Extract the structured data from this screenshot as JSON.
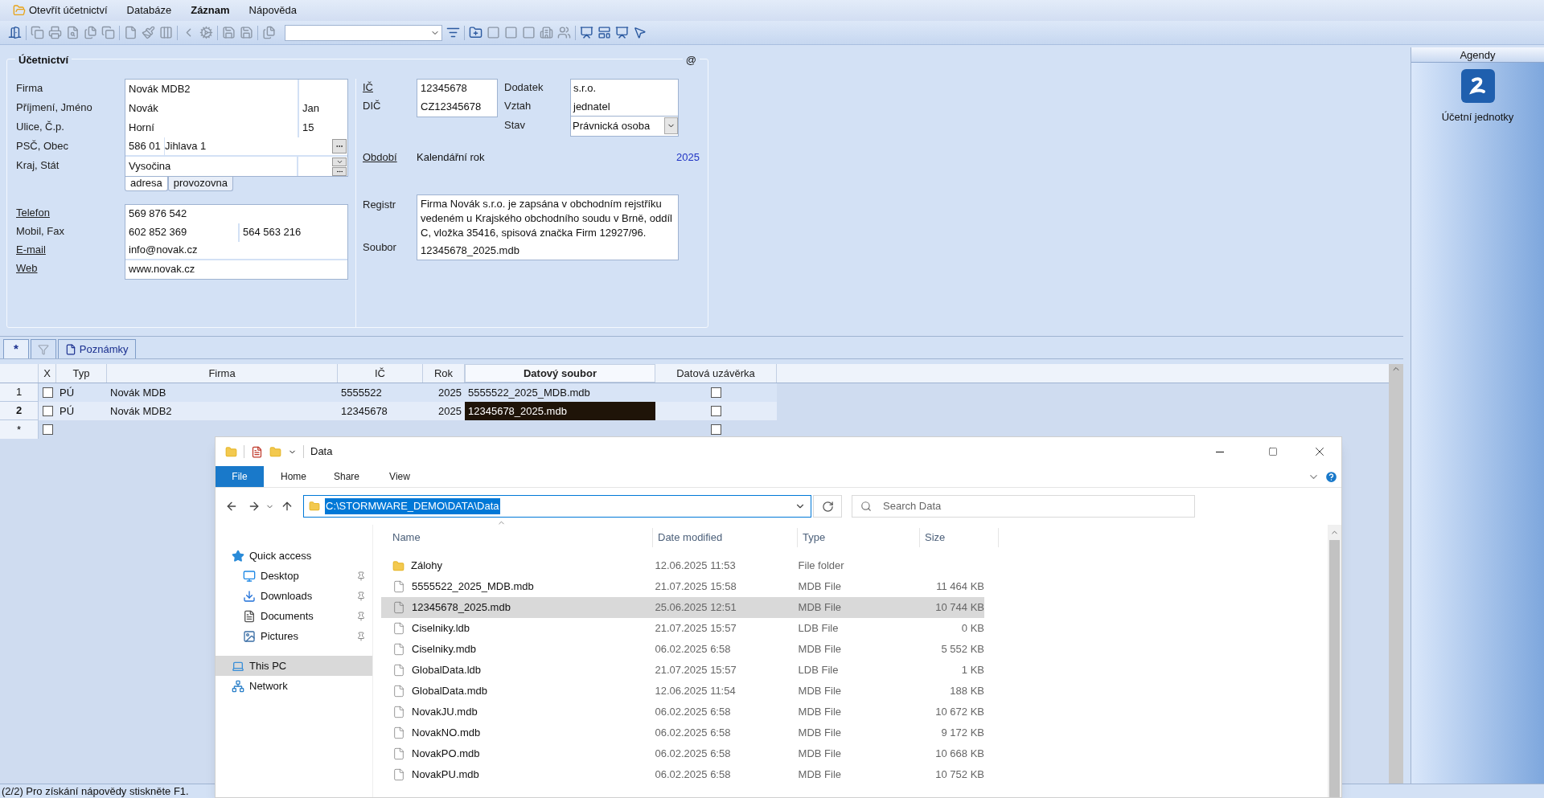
{
  "menu": [
    {
      "label": "Otevřít účetnictví",
      "bold": false
    },
    {
      "label": "Databáze",
      "bold": false
    },
    {
      "label": "Záznam",
      "bold": true
    },
    {
      "label": "Nápověda",
      "bold": false
    }
  ],
  "form": {
    "legend": "Účetnictví",
    "at_sign": "@",
    "address_rows": [
      {
        "label": "Firma",
        "link": false,
        "value": "Novák MDB2",
        "kind": "split"
      },
      {
        "label": "Příjmení, Jméno",
        "link": false,
        "value": "Novák",
        "second": "Jan",
        "kind": "split"
      },
      {
        "label": "Ulice, Č.p.",
        "link": false,
        "value": "Horní",
        "second": "15",
        "kind": "split"
      },
      {
        "label": "PSČ, Obec",
        "link": false,
        "value": "586 01",
        "second": "Jihlava 1",
        "kind": "zip"
      },
      {
        "label": "Kraj, Stát",
        "link": false,
        "value": "Vysočina",
        "kind": "region"
      }
    ],
    "address_tabs": [
      {
        "label": "adresa",
        "selected": true
      },
      {
        "label": "provozovna",
        "selected": false
      }
    ],
    "contact_rows": [
      {
        "label": "Telefon",
        "link": true,
        "value": "569 876 542"
      },
      {
        "label": "Mobil, Fax",
        "link": false,
        "value": "602 852 369",
        "second": "564 563 216"
      },
      {
        "label": "E-mail",
        "link": true,
        "value": "info@novak.cz"
      },
      {
        "label": "Web",
        "link": true,
        "value": "www.novak.cz"
      }
    ],
    "ic": {
      "label": "IČ",
      "link": true,
      "value": "12345678"
    },
    "dic": {
      "label": "DIČ",
      "link": false,
      "value": "CZ12345678"
    },
    "dodatek": {
      "label": "Dodatek",
      "value": "s.r.o."
    },
    "vztah": {
      "label": "Vztah",
      "value": "jednatel"
    },
    "stav": {
      "label": "Stav",
      "value": "Právnická osoba"
    },
    "obdobi": {
      "label": "Období",
      "link": true,
      "value": "Kalendářní rok",
      "year": "2025"
    },
    "registr": {
      "label": "Registr",
      "value": "Firma Novák s.r.o. je zapsána v obchodním rejstříku vedeném u Krajského obchodního soudu v Brně, oddíl C, vložka 35416, spisová značka Firm 12927/96."
    },
    "soubor": {
      "label": "Soubor",
      "value": "12345678_2025.mdb"
    }
  },
  "grid_tabs": [
    {
      "kind": "star",
      "label": "*",
      "selected": true
    },
    {
      "kind": "filter",
      "selected": false,
      "disabled": true
    },
    {
      "kind": "notes",
      "label": "Poznámky",
      "selected": false
    }
  ],
  "grid": {
    "columns": [
      {
        "label": "X",
        "bold": false
      },
      {
        "label": "Typ",
        "bold": false
      },
      {
        "label": "Firma",
        "bold": false
      },
      {
        "label": "IČ",
        "bold": false
      },
      {
        "label": "Rok",
        "bold": false
      },
      {
        "label": "Datový soubor",
        "bold": true
      },
      {
        "label": "Datová uzávěrka",
        "bold": false
      }
    ],
    "rows": [
      {
        "marker": "1",
        "selected": false,
        "x": false,
        "typ": "PÚ",
        "firma": "Novák MDB",
        "ic": "5555522",
        "rok": "2025",
        "soubor": "5555522_2025_MDB.mdb",
        "soubor_selected": false,
        "uzaverka": false
      },
      {
        "marker": "2",
        "selected": true,
        "x": false,
        "typ": "PÚ",
        "firma": "Novák MDB2",
        "ic": "12345678",
        "rok": "2025",
        "soubor": "12345678_2025.mdb",
        "soubor_selected": true,
        "uzaverka": false
      }
    ],
    "new_row": {
      "marker": "*",
      "x": false,
      "uzaverka": false
    }
  },
  "agendy": {
    "title": "Agendy",
    "items": [
      {
        "label": "Účetní jednotky"
      }
    ]
  },
  "status_bar": "(2/2) Pro získání nápovědy stiskněte F1.",
  "explorer": {
    "title": "Data",
    "ribbon_tabs": [
      {
        "label": "File",
        "selected": true
      },
      {
        "label": "Home",
        "selected": false
      },
      {
        "label": "Share",
        "selected": false
      },
      {
        "label": "View",
        "selected": false
      }
    ],
    "address": "C:\\STORMWARE_DEMO\\DATA\\Data",
    "search": {
      "placeholder": "Search Data"
    },
    "nav": [
      {
        "label": "Quick access",
        "kind": "star",
        "selected": false,
        "children": [
          {
            "label": "Desktop",
            "kind": "desktop",
            "selected": false,
            "pinned": true
          },
          {
            "label": "Downloads",
            "kind": "download",
            "selected": false,
            "pinned": true
          },
          {
            "label": "Documents",
            "kind": "document",
            "selected": false,
            "pinned": true
          },
          {
            "label": "Pictures",
            "kind": "picture",
            "selected": false,
            "pinned": true
          }
        ]
      },
      {
        "label": "This PC",
        "kind": "pc",
        "selected": true
      },
      {
        "label": "Network",
        "kind": "network",
        "selected": false
      }
    ],
    "columns": [
      "Name",
      "Date modified",
      "Type",
      "Size"
    ],
    "files": [
      {
        "name": "Zálohy",
        "kind": "folder",
        "date": "12.06.2025 11:53",
        "type": "File folder",
        "selected": false
      },
      {
        "name": "5555522_2025_MDB.mdb",
        "kind": "file",
        "date": "21.07.2025 15:58",
        "type": "MDB File",
        "size": "11 464 KB",
        "selected": false
      },
      {
        "name": "12345678_2025.mdb",
        "kind": "file",
        "date": "25.06.2025 12:51",
        "type": "MDB File",
        "size": "10 744 KB",
        "selected": true
      },
      {
        "name": "Ciselniky.ldb",
        "kind": "file",
        "date": "21.07.2025 15:57",
        "type": "LDB File",
        "size": "0 KB",
        "selected": false
      },
      {
        "name": "Ciselniky.mdb",
        "kind": "file",
        "date": "06.02.2025 6:58",
        "type": "MDB File",
        "size": "5 552 KB",
        "selected": false
      },
      {
        "name": "GlobalData.ldb",
        "kind": "file",
        "date": "21.07.2025 15:57",
        "type": "LDB File",
        "size": "1 KB",
        "selected": false
      },
      {
        "name": "GlobalData.mdb",
        "kind": "file",
        "date": "12.06.2025 11:54",
        "type": "MDB File",
        "size": "188 KB",
        "selected": false
      },
      {
        "name": "NovakJU.mdb",
        "kind": "file",
        "date": "06.02.2025 6:58",
        "type": "MDB File",
        "size": "10 672 KB",
        "selected": false
      },
      {
        "name": "NovakNO.mdb",
        "kind": "file",
        "date": "06.02.2025 6:58",
        "type": "MDB File",
        "size": "9 172 KB",
        "selected": false
      },
      {
        "name": "NovakPO.mdb",
        "kind": "file",
        "date": "06.02.2025 6:58",
        "type": "MDB File",
        "size": "10 668 KB",
        "selected": false
      },
      {
        "name": "NovakPU.mdb",
        "kind": "file",
        "date": "06.02.2025 6:58",
        "type": "MDB File",
        "size": "10 752 KB",
        "selected": false
      }
    ]
  }
}
